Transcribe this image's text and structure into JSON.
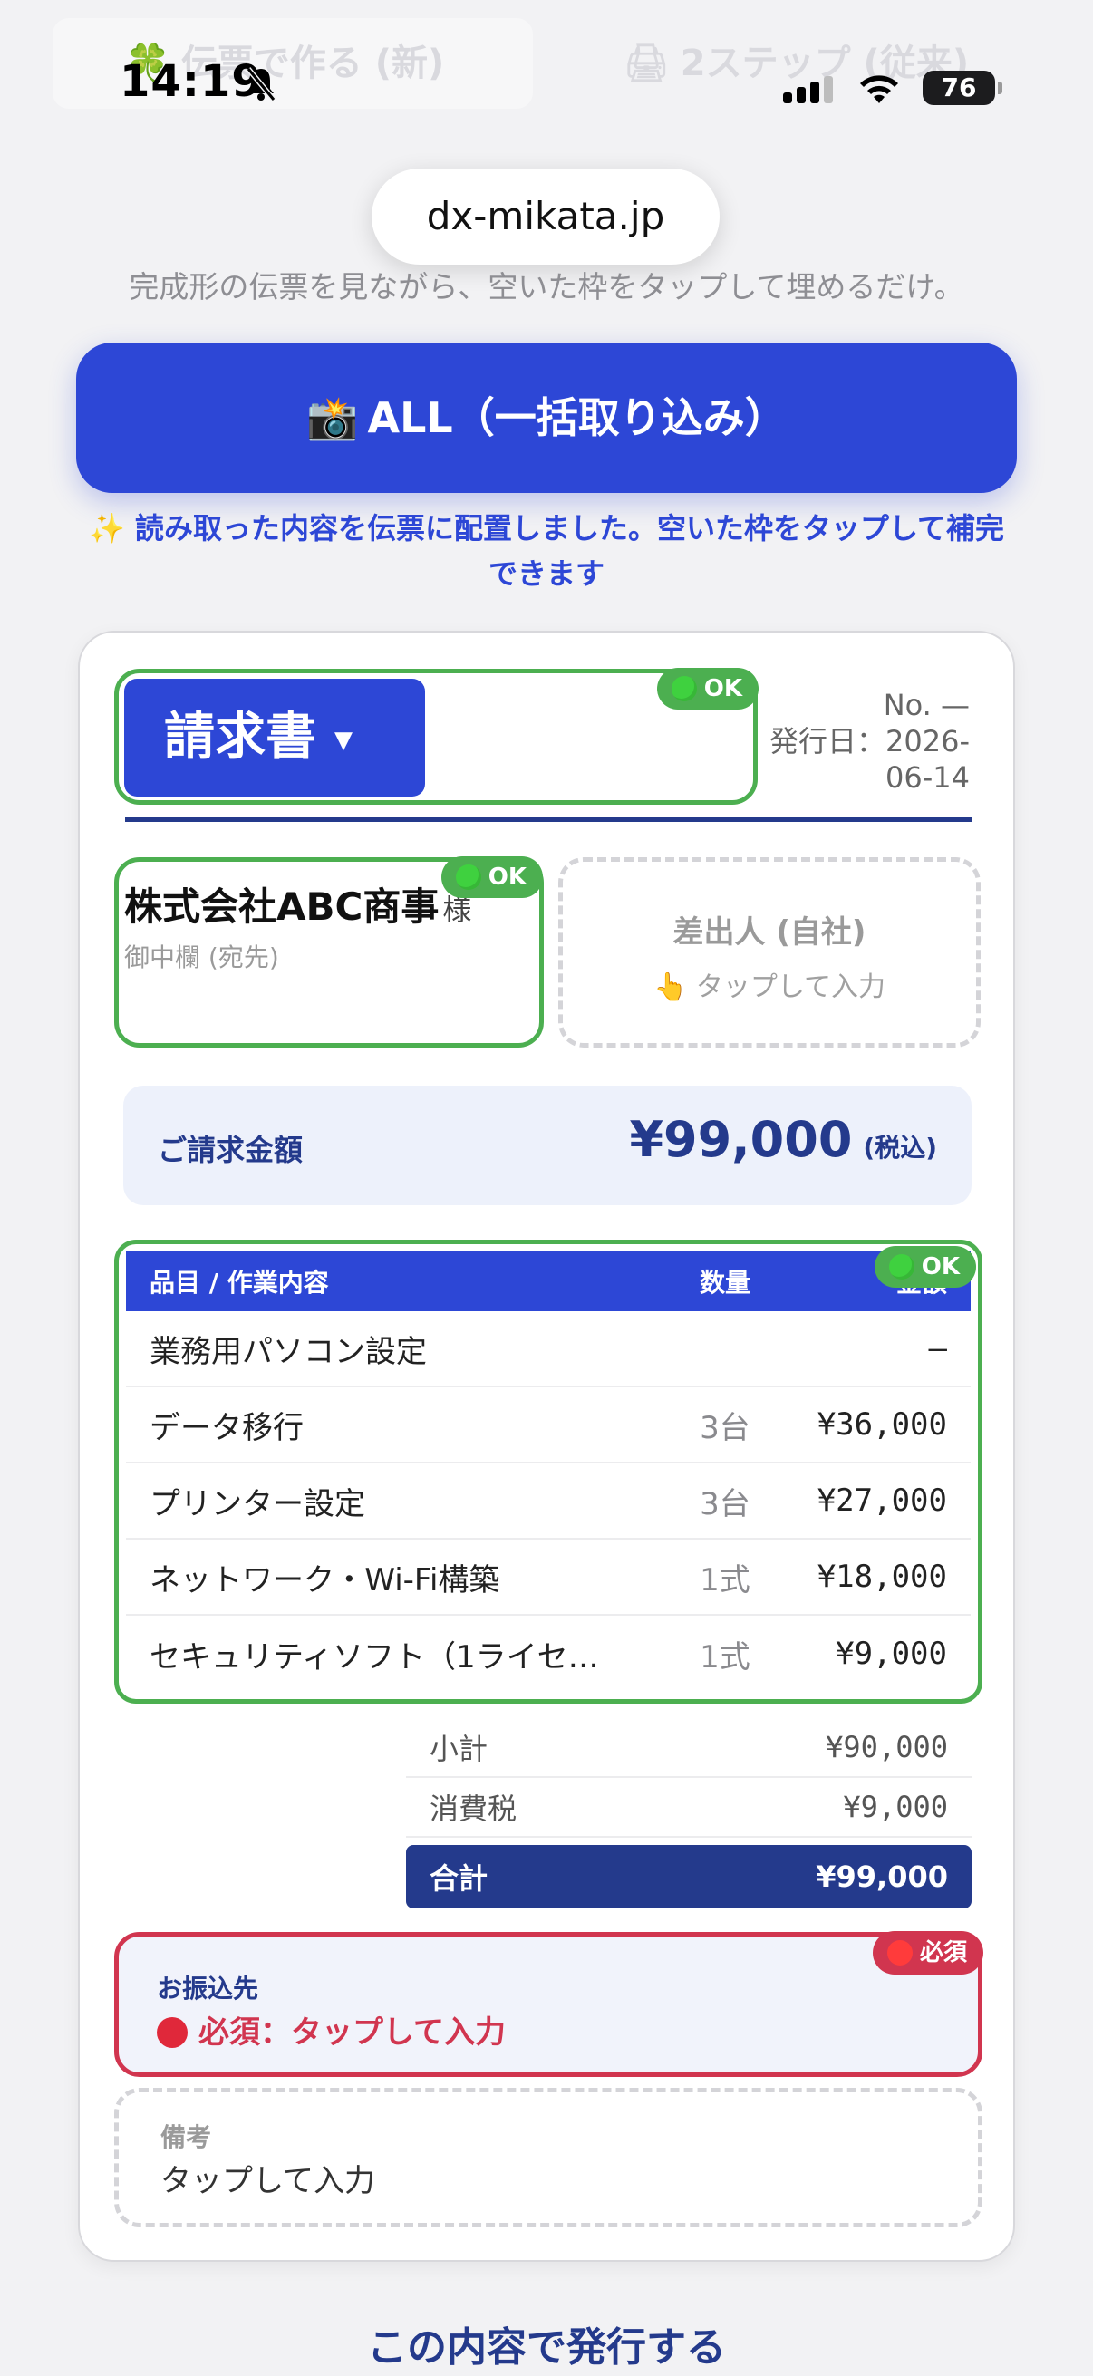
{
  "status": {
    "time": "14:19",
    "battery": "76"
  },
  "tabs": [
    {
      "icon": "🍀",
      "label": "伝票で作る (新)"
    },
    {
      "icon": "🖨",
      "label": "2ステップ (従来)"
    }
  ],
  "url": "dx-mikata.jp",
  "subtitle": "完成形の伝票を見ながら、空いた枠をタップして埋めるだけ。",
  "capture_button": {
    "icon": "📸",
    "label": "ALL（一括取り込み）"
  },
  "info_message": "✨ 読み取った内容を伝票に配置しました。空いた枠をタップして補完できます",
  "invoice": {
    "doc_type": "請求書",
    "caret": "▼",
    "ok_label": "OK",
    "number": "No. —",
    "issue_date_label": "発行日：2026-06-14",
    "recipient": {
      "name": "株式会社ABC商事",
      "suffix": "様",
      "label": "御中欄 (宛先)"
    },
    "sender": {
      "title": "差出人 (自社)",
      "hint": "👆 タップして入力"
    },
    "amount": {
      "label": "ご請求金額",
      "value": "¥99,000",
      "tax": "(税込)"
    },
    "columns": {
      "name": "品目 / 作業内容",
      "qty": "数量",
      "amount": "金額"
    },
    "items": [
      {
        "name": "業務用パソコン設定",
        "qty": "",
        "amount": "—"
      },
      {
        "name": "データ移行",
        "qty": "3台",
        "amount": "¥36,000"
      },
      {
        "name": "プリンター設定",
        "qty": "3台",
        "amount": "¥27,000"
      },
      {
        "name": "ネットワーク・Wi-Fi構築",
        "qty": "1式",
        "amount": "¥18,000"
      },
      {
        "name": "セキュリティソフト（1ライセ…",
        "qty": "1式",
        "amount": "¥9,000"
      }
    ],
    "totals": {
      "subtotal_label": "小計",
      "subtotal": "¥90,000",
      "tax_label": "消費税",
      "tax": "¥9,000",
      "total_label": "合計",
      "total": "¥99,000"
    },
    "bank": {
      "label": "お振込先",
      "required": "必須：タップして入力",
      "badge": "必須"
    },
    "note": {
      "label": "備考",
      "hint": "タップして入力"
    }
  },
  "issue_button": "この内容で発行する",
  "colors": {
    "primary": "#2d47d6",
    "navy": "#243a8c",
    "ok": "#4caf50",
    "required": "#d1354f"
  }
}
